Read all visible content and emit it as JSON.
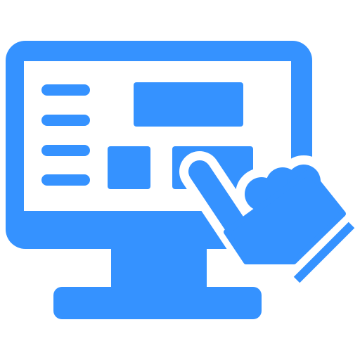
{
  "icon": {
    "name": "monitor-touch-icon",
    "color": "#3592FF",
    "background": "#FFFFFF"
  },
  "parts": {
    "menu_lines": 4,
    "screen_blocks": 3
  }
}
